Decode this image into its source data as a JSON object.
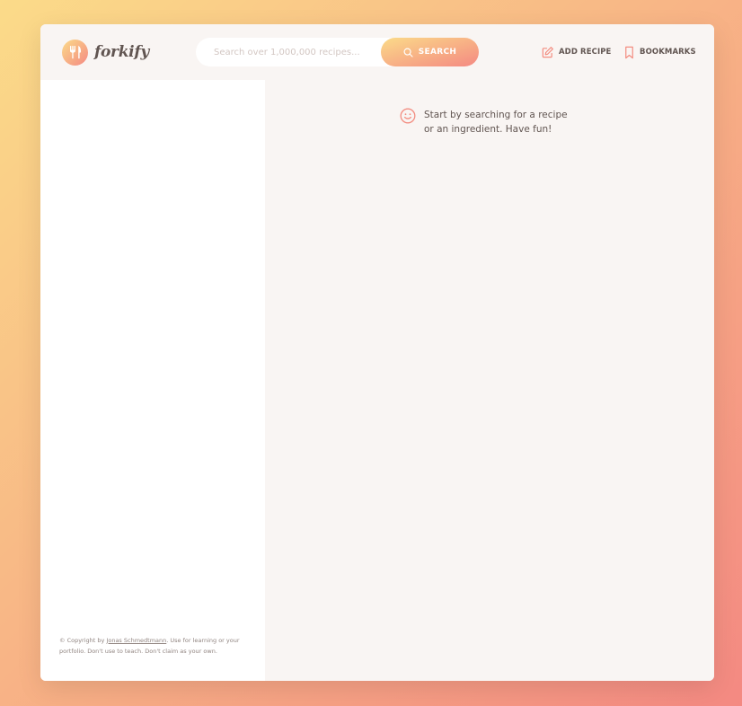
{
  "header": {
    "logo_text": "forkify",
    "search": {
      "placeholder": "Search over 1,000,000 recipes...",
      "value": "",
      "button_label": "SEARCH"
    },
    "nav": {
      "add_recipe_label": "ADD RECIPE",
      "bookmarks_label": "BOOKMARKS"
    }
  },
  "main": {
    "message": "Start by searching for a recipe or an ingredient. Have fun!"
  },
  "sidebar": {
    "copyright_prefix": "© Copyright by ",
    "copyright_link": "Jonas Schmedtmann",
    "copyright_suffix": ". Use for learning or your portfolio. Don't use to teach. Don't claim as your own."
  },
  "icons": {
    "logo": "fork-knife-icon",
    "search": "search-icon",
    "add_recipe": "edit-icon",
    "bookmarks": "bookmark-icon",
    "message": "smile-icon"
  },
  "colors": {
    "gradient_start": "#fbdb89",
    "gradient_end": "#f48982",
    "accent": "#f38e82",
    "text": "#615551",
    "panel_bg": "#f9f5f3"
  }
}
